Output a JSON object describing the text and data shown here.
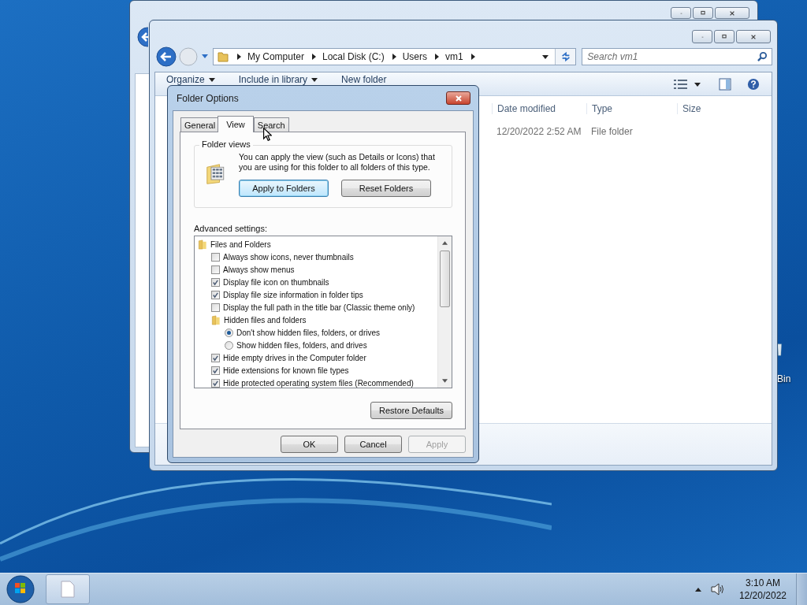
{
  "explorer": {
    "address": {
      "breadcrumbs": [
        "My Computer",
        "Local Disk (C:)",
        "Users",
        "vm1"
      ]
    },
    "search": {
      "placeholder": "Search vm1"
    },
    "toolbar": [
      {
        "label": "Organize",
        "dropdown": true
      },
      {
        "label": "Include in library",
        "dropdown": true
      },
      {
        "label": "New folder",
        "dropdown": false
      }
    ],
    "columns": [
      "Date modified",
      "Type",
      "Size"
    ],
    "rows": [
      {
        "date_modified": "12/20/2022 2:52 AM",
        "type": "File folder"
      }
    ]
  },
  "dialog": {
    "title": "Folder Options",
    "tabs": [
      {
        "label": "General",
        "selected": false
      },
      {
        "label": "View",
        "selected": true
      },
      {
        "label": "Search",
        "selected": false
      }
    ],
    "folder_views": {
      "heading": "Folder views",
      "description": "You can apply the view (such as Details or Icons) that you are using for this folder to all folders of this type.",
      "buttons": [
        {
          "label": "Apply to Folders",
          "focused": true
        },
        {
          "label": "Reset Folders",
          "focused": false
        }
      ]
    },
    "advanced_label": "Advanced settings:",
    "advanced_settings": [
      {
        "kind": "folder",
        "label": "Files and Folders",
        "children": [
          {
            "kind": "checkbox",
            "label": "Always show icons, never thumbnails",
            "checked": false
          },
          {
            "kind": "checkbox",
            "label": "Always show menus",
            "checked": false
          },
          {
            "kind": "checkbox",
            "label": "Display file icon on thumbnails",
            "checked": true
          },
          {
            "kind": "checkbox",
            "label": "Display file size information in folder tips",
            "checked": true
          },
          {
            "kind": "checkbox",
            "label": "Display the full path in the title bar (Classic theme only)",
            "checked": false
          },
          {
            "kind": "folder",
            "label": "Hidden files and folders",
            "children": [
              {
                "kind": "radio",
                "label": "Don't show hidden files, folders, or drives",
                "selected": true
              },
              {
                "kind": "radio",
                "label": "Show hidden files, folders, and drives",
                "selected": false
              }
            ]
          },
          {
            "kind": "checkbox",
            "label": "Hide empty drives in the Computer folder",
            "checked": true
          },
          {
            "kind": "checkbox",
            "label": "Hide extensions for known file types",
            "checked": true
          },
          {
            "kind": "checkbox",
            "label": "Hide protected operating system files (Recommended)",
            "checked": true
          }
        ]
      }
    ],
    "restore_button": "Restore Defaults",
    "buttons": [
      {
        "label": "OK",
        "disabled": false
      },
      {
        "label": "Cancel",
        "disabled": false
      },
      {
        "label": "Apply",
        "disabled": true
      }
    ]
  },
  "desktop_icons": [
    {
      "label": "Bin"
    }
  ],
  "taskbar": {
    "clock": {
      "time": "3:10 AM",
      "date": "12/20/2022"
    }
  }
}
